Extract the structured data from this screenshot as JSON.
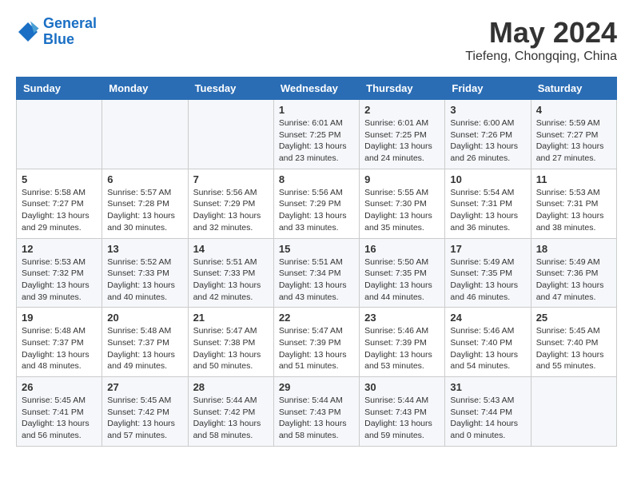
{
  "header": {
    "logo_line1": "General",
    "logo_line2": "Blue",
    "month": "May 2024",
    "location": "Tiefeng, Chongqing, China"
  },
  "days_of_week": [
    "Sunday",
    "Monday",
    "Tuesday",
    "Wednesday",
    "Thursday",
    "Friday",
    "Saturday"
  ],
  "weeks": [
    [
      {
        "num": "",
        "info": ""
      },
      {
        "num": "",
        "info": ""
      },
      {
        "num": "",
        "info": ""
      },
      {
        "num": "1",
        "info": "Sunrise: 6:01 AM\nSunset: 7:25 PM\nDaylight: 13 hours\nand 23 minutes."
      },
      {
        "num": "2",
        "info": "Sunrise: 6:01 AM\nSunset: 7:25 PM\nDaylight: 13 hours\nand 24 minutes."
      },
      {
        "num": "3",
        "info": "Sunrise: 6:00 AM\nSunset: 7:26 PM\nDaylight: 13 hours\nand 26 minutes."
      },
      {
        "num": "4",
        "info": "Sunrise: 5:59 AM\nSunset: 7:27 PM\nDaylight: 13 hours\nand 27 minutes."
      }
    ],
    [
      {
        "num": "5",
        "info": "Sunrise: 5:58 AM\nSunset: 7:27 PM\nDaylight: 13 hours\nand 29 minutes."
      },
      {
        "num": "6",
        "info": "Sunrise: 5:57 AM\nSunset: 7:28 PM\nDaylight: 13 hours\nand 30 minutes."
      },
      {
        "num": "7",
        "info": "Sunrise: 5:56 AM\nSunset: 7:29 PM\nDaylight: 13 hours\nand 32 minutes."
      },
      {
        "num": "8",
        "info": "Sunrise: 5:56 AM\nSunset: 7:29 PM\nDaylight: 13 hours\nand 33 minutes."
      },
      {
        "num": "9",
        "info": "Sunrise: 5:55 AM\nSunset: 7:30 PM\nDaylight: 13 hours\nand 35 minutes."
      },
      {
        "num": "10",
        "info": "Sunrise: 5:54 AM\nSunset: 7:31 PM\nDaylight: 13 hours\nand 36 minutes."
      },
      {
        "num": "11",
        "info": "Sunrise: 5:53 AM\nSunset: 7:31 PM\nDaylight: 13 hours\nand 38 minutes."
      }
    ],
    [
      {
        "num": "12",
        "info": "Sunrise: 5:53 AM\nSunset: 7:32 PM\nDaylight: 13 hours\nand 39 minutes."
      },
      {
        "num": "13",
        "info": "Sunrise: 5:52 AM\nSunset: 7:33 PM\nDaylight: 13 hours\nand 40 minutes."
      },
      {
        "num": "14",
        "info": "Sunrise: 5:51 AM\nSunset: 7:33 PM\nDaylight: 13 hours\nand 42 minutes."
      },
      {
        "num": "15",
        "info": "Sunrise: 5:51 AM\nSunset: 7:34 PM\nDaylight: 13 hours\nand 43 minutes."
      },
      {
        "num": "16",
        "info": "Sunrise: 5:50 AM\nSunset: 7:35 PM\nDaylight: 13 hours\nand 44 minutes."
      },
      {
        "num": "17",
        "info": "Sunrise: 5:49 AM\nSunset: 7:35 PM\nDaylight: 13 hours\nand 46 minutes."
      },
      {
        "num": "18",
        "info": "Sunrise: 5:49 AM\nSunset: 7:36 PM\nDaylight: 13 hours\nand 47 minutes."
      }
    ],
    [
      {
        "num": "19",
        "info": "Sunrise: 5:48 AM\nSunset: 7:37 PM\nDaylight: 13 hours\nand 48 minutes."
      },
      {
        "num": "20",
        "info": "Sunrise: 5:48 AM\nSunset: 7:37 PM\nDaylight: 13 hours\nand 49 minutes."
      },
      {
        "num": "21",
        "info": "Sunrise: 5:47 AM\nSunset: 7:38 PM\nDaylight: 13 hours\nand 50 minutes."
      },
      {
        "num": "22",
        "info": "Sunrise: 5:47 AM\nSunset: 7:39 PM\nDaylight: 13 hours\nand 51 minutes."
      },
      {
        "num": "23",
        "info": "Sunrise: 5:46 AM\nSunset: 7:39 PM\nDaylight: 13 hours\nand 53 minutes."
      },
      {
        "num": "24",
        "info": "Sunrise: 5:46 AM\nSunset: 7:40 PM\nDaylight: 13 hours\nand 54 minutes."
      },
      {
        "num": "25",
        "info": "Sunrise: 5:45 AM\nSunset: 7:40 PM\nDaylight: 13 hours\nand 55 minutes."
      }
    ],
    [
      {
        "num": "26",
        "info": "Sunrise: 5:45 AM\nSunset: 7:41 PM\nDaylight: 13 hours\nand 56 minutes."
      },
      {
        "num": "27",
        "info": "Sunrise: 5:45 AM\nSunset: 7:42 PM\nDaylight: 13 hours\nand 57 minutes."
      },
      {
        "num": "28",
        "info": "Sunrise: 5:44 AM\nSunset: 7:42 PM\nDaylight: 13 hours\nand 58 minutes."
      },
      {
        "num": "29",
        "info": "Sunrise: 5:44 AM\nSunset: 7:43 PM\nDaylight: 13 hours\nand 58 minutes."
      },
      {
        "num": "30",
        "info": "Sunrise: 5:44 AM\nSunset: 7:43 PM\nDaylight: 13 hours\nand 59 minutes."
      },
      {
        "num": "31",
        "info": "Sunrise: 5:43 AM\nSunset: 7:44 PM\nDaylight: 14 hours\nand 0 minutes."
      },
      {
        "num": "",
        "info": ""
      }
    ]
  ]
}
